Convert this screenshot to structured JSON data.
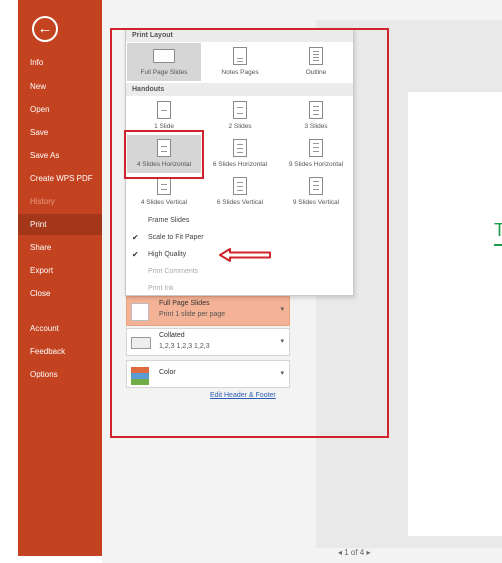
{
  "nav": {
    "back_icon": "←",
    "items": [
      {
        "label": "Info"
      },
      {
        "label": "New"
      },
      {
        "label": "Open"
      },
      {
        "label": "Save"
      },
      {
        "label": "Save As"
      },
      {
        "label": "Create WPS PDF"
      },
      {
        "label": "History"
      },
      {
        "label": "Print"
      },
      {
        "label": "Share"
      },
      {
        "label": "Export"
      },
      {
        "label": "Close"
      },
      {
        "label": "Account"
      },
      {
        "label": "Feedback"
      },
      {
        "label": "Options"
      }
    ],
    "active": "Print"
  },
  "dropdown": {
    "print_layout_header": "Print Layout",
    "print_layout": [
      {
        "label": "Full Page Slides"
      },
      {
        "label": "Notes Pages"
      },
      {
        "label": "Outline"
      }
    ],
    "handouts_header": "Handouts",
    "handouts": [
      {
        "label": "1 Slide"
      },
      {
        "label": "2 Slides"
      },
      {
        "label": "3 Slides"
      },
      {
        "label": "4 Slides Horizontal"
      },
      {
        "label": "6 Slides Horizontal"
      },
      {
        "label": "9 Slides Horizontal"
      },
      {
        "label": "4 Slides Vertical"
      },
      {
        "label": "6 Slides Vertical"
      },
      {
        "label": "9 Slides Vertical"
      }
    ],
    "options": {
      "frame_slides": "Frame Slides",
      "scale_to_fit": "Scale to Fit Paper",
      "high_quality": "High Quality",
      "print_comments": "Print Comments",
      "print_ink": "Print Ink"
    },
    "checkmark": "✔"
  },
  "settings": {
    "layout_title": "Full Page Slides",
    "layout_sub": "Print 1 slide per page",
    "collated_title": "Collated",
    "collated_sub": "1,2,3   1,2,3   1,2,3",
    "color_title": "Color",
    "arrow": "▾",
    "edit_link": "Edit Header & Footer"
  },
  "preview": {
    "slide_text": "T",
    "page_nav": "◂  1  of 4  ▸"
  },
  "colors": {
    "backstage": "#c34321",
    "annotation": "#d0242b",
    "highlight": "#f4b296"
  }
}
